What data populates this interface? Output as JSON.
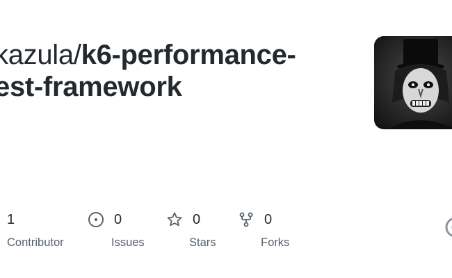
{
  "repo": {
    "owner": "kazula/",
    "name_line1": "k6-performance-",
    "name_line2": "est-framework"
  },
  "avatar": {
    "icon": "avatar-hat-figure"
  },
  "stats": {
    "contributors": {
      "count": "1",
      "label": "Contributor"
    },
    "issues": {
      "count": "0",
      "label": "Issues",
      "icon": "issue-opened-icon"
    },
    "stars": {
      "count": "0",
      "label": "Stars",
      "icon": "star-icon"
    },
    "forks": {
      "count": "0",
      "label": "Forks",
      "icon": "fork-icon"
    }
  },
  "colors": {
    "text": "#24292f",
    "muted": "#57606a",
    "background": "#ffffff"
  }
}
